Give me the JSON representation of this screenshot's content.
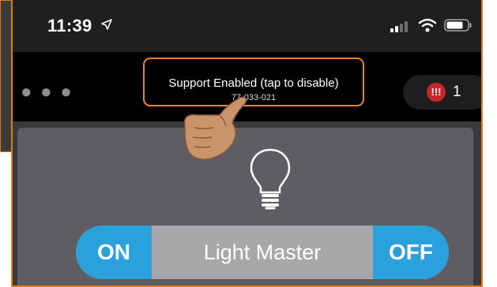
{
  "status_bar": {
    "time": "11:39",
    "location_icon": "location-arrow-icon",
    "signal_icon": "cellular-signal-icon",
    "wifi_icon": "wifi-icon",
    "battery_icon": "battery-icon"
  },
  "header": {
    "more_icon": "more-dots-icon",
    "support_label": "Support Enabled (tap to disable)",
    "support_id": "77-033-021",
    "alert_icon": "alert-icon",
    "alert_symbol": "!!!",
    "alert_count": "1"
  },
  "device": {
    "icon": "light-bulb-icon",
    "on_label": "ON",
    "name": "Light Master",
    "off_label": "OFF"
  },
  "overlay": {
    "pointer_icon": "hand-pointer-icon"
  },
  "colors": {
    "accent_orange": "#e88524",
    "button_blue": "#2aa1dc",
    "alert_red": "#c62828"
  }
}
